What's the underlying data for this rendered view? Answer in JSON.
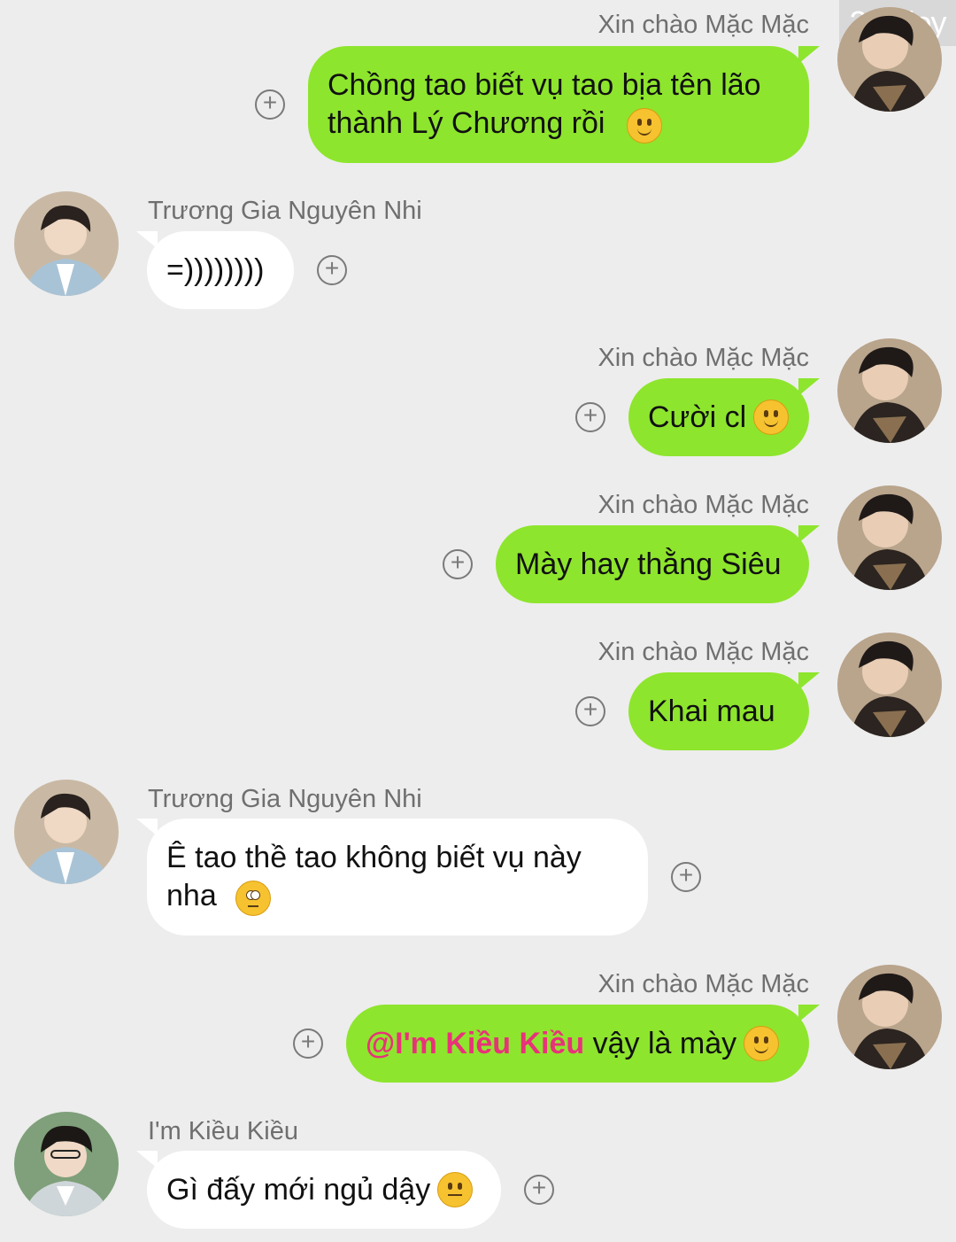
{
  "watermark": "226 joy",
  "colors": {
    "my_bubble": "#8ee52d",
    "their_bubble": "#ffffff",
    "background": "#ededed",
    "mention": "#e8327a"
  },
  "messages": [
    {
      "sender": "Xin chào Mặc Mặc",
      "text": "Chồng tao biết vụ tao bịa tên lão\nthành Lý Chương rồi",
      "emoji": "slightly-smiling-face-icon"
    },
    {
      "sender": "Trương Gia Nguyên Nhi",
      "text": "=))))))))"
    },
    {
      "sender": "Xin chào Mặc Mặc",
      "text": "Cười cl",
      "emoji": "slightly-smiling-face-icon"
    },
    {
      "sender": "Xin chào Mặc Mặc",
      "text": "Mày hay thằng Siêu"
    },
    {
      "sender": "Xin chào Mặc Mặc",
      "text": "Khai mau"
    },
    {
      "sender": "Trương Gia Nguyên Nhi",
      "text": "Ê tao thề tao không biết vụ này\nnha",
      "emoji": "rolling-eyes-face-icon"
    },
    {
      "sender": "Xin chào Mặc Mặc",
      "mention": "@I'm Kiều Kiều",
      "text": " vậy là mày",
      "emoji": "slightly-smiling-face-icon"
    },
    {
      "sender": "I'm Kiều Kiều",
      "text": "Gì đấy mới ngủ dậy",
      "emoji": "face-with-steam-icon"
    }
  ]
}
